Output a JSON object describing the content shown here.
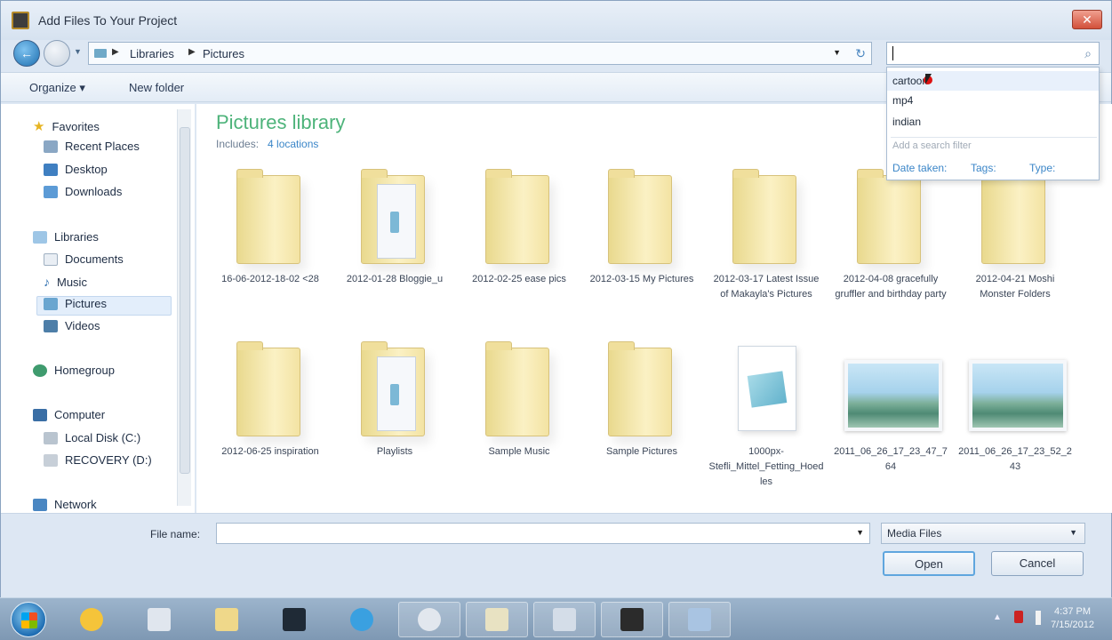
{
  "window": {
    "title": "Add Files To Your Project",
    "close_glyph": "✕"
  },
  "address_bar": {
    "crumbs": [
      "Libraries",
      "Pictures"
    ],
    "search_value": ""
  },
  "toolbar": {
    "organize_label": "Organize ▾",
    "new_folder_label": "New folder"
  },
  "nav_pane": {
    "favorites_label": "Favorites",
    "favorites": [
      "Recent Places",
      "Desktop",
      "Downloads"
    ],
    "libraries_label": "Libraries",
    "libraries": [
      "Documents",
      "Music",
      "Pictures",
      "Videos"
    ],
    "homegroup_label": "Homegroup",
    "computer_label": "Computer",
    "computer": [
      "Local Disk (C:)",
      "RECOVERY (D:)"
    ],
    "network_label": "Network"
  },
  "library": {
    "title": "Pictures library",
    "includes_label": "Includes:",
    "locations_label": "4 locations"
  },
  "items": [
    {
      "label": "16-06-2012-18-02 <28",
      "kind": "folder"
    },
    {
      "label": "2012-01-28 Bloggie_u",
      "kind": "folder-doc"
    },
    {
      "label": "2012-02-25 ease pics",
      "kind": "folder"
    },
    {
      "label": "2012-03-15 My Pictures",
      "kind": "folder"
    },
    {
      "label": "2012-03-17 Latest Issue of Makayla's Pictures",
      "kind": "folder"
    },
    {
      "label": "2012-04-08 gracefully gruffler and birthday party",
      "kind": "folder"
    },
    {
      "label": "2012-04-21 Moshi Monster Folders",
      "kind": "folder"
    },
    {
      "label": "2012-06-25 inspiration",
      "kind": "folder"
    },
    {
      "label": "Playlists",
      "kind": "folder-doc"
    },
    {
      "label": "Sample Music",
      "kind": "folder"
    },
    {
      "label": "Sample Pictures",
      "kind": "folder"
    },
    {
      "label": "1000px-Stefli_Mittel_Fetting_Hoedles",
      "kind": "document"
    },
    {
      "label": "2011_06_26_17_23_47_764",
      "kind": "photo"
    },
    {
      "label": "2011_06_26_17_23_52_243",
      "kind": "photo"
    }
  ],
  "search_suggestions": {
    "history": [
      "cartoon",
      "mp4",
      "indian"
    ],
    "filter_heading": "Add a search filter",
    "filters": [
      "Date taken:",
      "Tags:",
      "Type:"
    ]
  },
  "bottom": {
    "file_name_label": "File name:",
    "file_name_value": "",
    "file_type_value": "Media Files",
    "open_label": "Open",
    "cancel_label": "Cancel"
  },
  "taskbar": {
    "time": "4:37 PM",
    "date": "7/15/2012",
    "apps": [
      "windows-media-player-icon",
      "python-icon",
      "file-explorer-icon",
      "camera-icon",
      "internet-explorer-icon",
      "chrome-icon",
      "paint-icon",
      "window-icon",
      "star-app-icon",
      "save-disk-icon"
    ]
  },
  "colors": {
    "library_title": "#4db37a",
    "link": "#3b86c8"
  }
}
